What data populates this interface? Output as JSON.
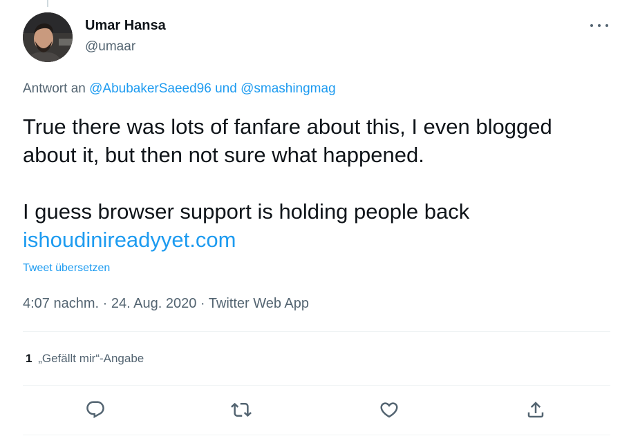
{
  "tweet": {
    "author": {
      "display_name": "Umar Hansa",
      "handle": "@umaar"
    },
    "reply": {
      "prefix": "Antwort an",
      "user1": "@AbubakerSaeed96",
      "connector": "und",
      "user2": "@smashingmag"
    },
    "text": {
      "line1": "True there was lots of fanfare about this, I even blogged about it, but then not sure what happened.",
      "line2": "I guess browser support is holding people back",
      "link": "ishoudinireadyyet.com"
    },
    "translate_label": "Tweet übersetzen",
    "meta": {
      "time": "4:07 nachm.",
      "separator1": "·",
      "date": "24. Aug. 2020",
      "separator2": "·",
      "source": "Twitter Web App"
    },
    "likes": {
      "count": "1",
      "label": "„Gefällt mir“-Angabe"
    },
    "actions": {
      "reply_icon": "reply-icon",
      "retweet_icon": "retweet-icon",
      "like_icon": "heart-icon",
      "share_icon": "share-icon"
    }
  },
  "colors": {
    "text_primary": "#0f1419",
    "text_secondary": "#536471",
    "link": "#1d9bf0",
    "divider": "#eff3f4"
  }
}
